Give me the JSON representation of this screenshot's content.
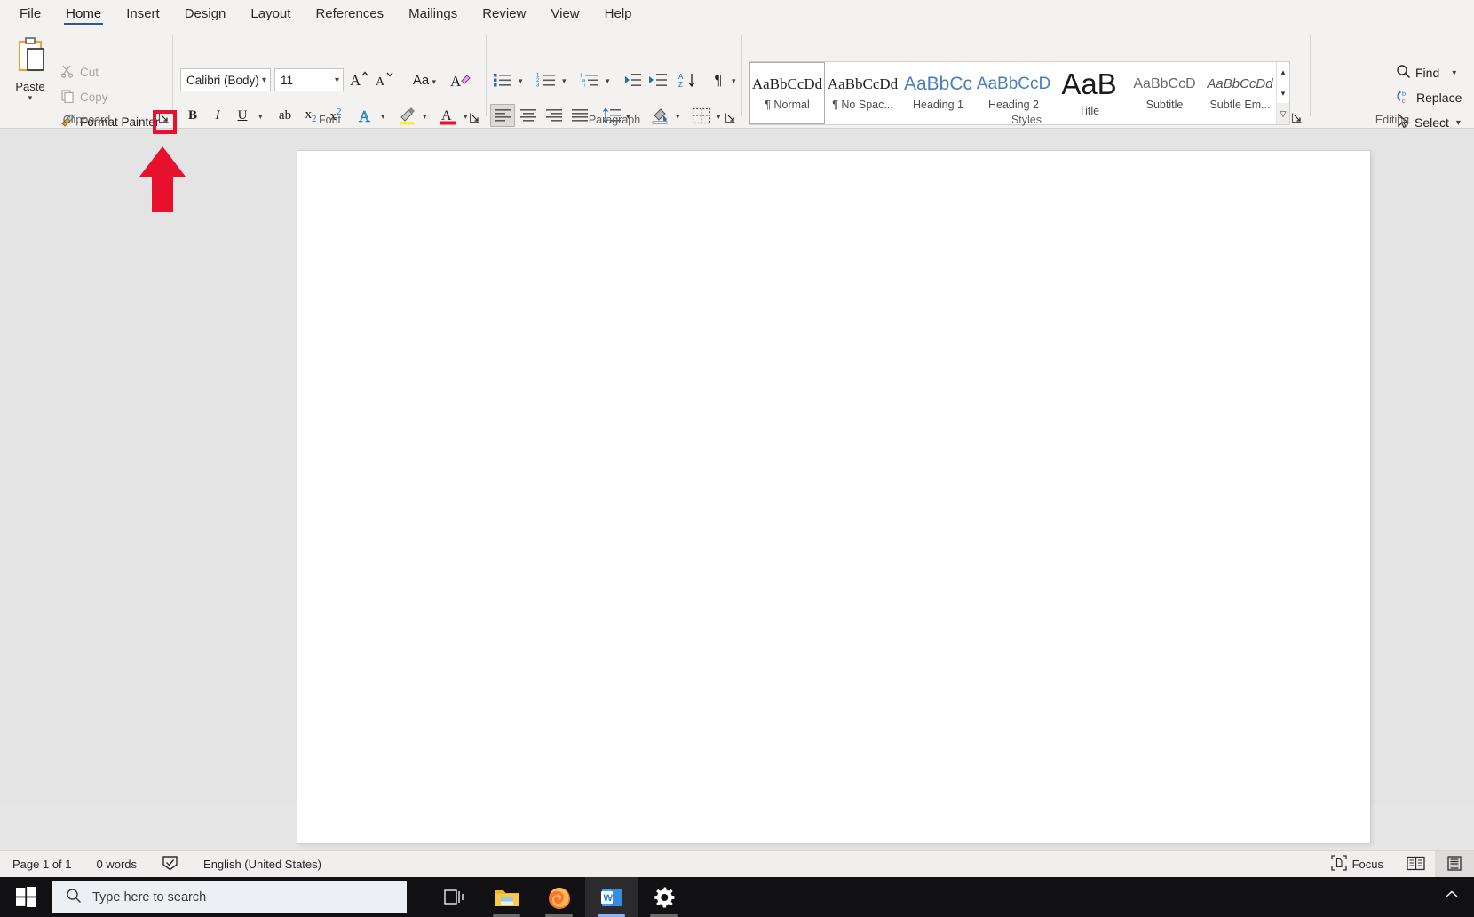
{
  "app": {
    "name": "Microsoft Word"
  },
  "ribbon": {
    "tabs": [
      {
        "label": "File",
        "active": false
      },
      {
        "label": "Home",
        "active": true
      },
      {
        "label": "Insert",
        "active": false
      },
      {
        "label": "Design",
        "active": false
      },
      {
        "label": "Layout",
        "active": false
      },
      {
        "label": "References",
        "active": false
      },
      {
        "label": "Mailings",
        "active": false
      },
      {
        "label": "Review",
        "active": false
      },
      {
        "label": "View",
        "active": false
      },
      {
        "label": "Help",
        "active": false
      }
    ],
    "clipboard": {
      "group_label": "Clipboard",
      "paste_label": "Paste",
      "cut_label": "Cut",
      "copy_label": "Copy",
      "format_painter_label": "Format Painter",
      "dialog_launcher_name": "Clipboard dialog launcher"
    },
    "font": {
      "group_label": "Font",
      "font_name": "Calibri (Body)",
      "font_size": "11",
      "grow_font": "Grow Font",
      "shrink_font": "Shrink Font",
      "change_case": "Change Case",
      "clear_formatting": "Clear All Formatting",
      "bold": "B",
      "italic": "I",
      "underline": "U",
      "strikethrough": "Strikethrough",
      "subscript": "Subscript",
      "superscript": "Superscript",
      "text_effects": "Text Effects and Typography",
      "highlight": "Text Highlight Color",
      "font_color": "Font Color"
    },
    "paragraph": {
      "group_label": "Paragraph",
      "bullets": "Bullets",
      "numbering": "Numbering",
      "multilevel": "Multilevel List",
      "decrease_indent": "Decrease Indent",
      "increase_indent": "Increase Indent",
      "sort": "Sort",
      "show_marks": "Show/Hide Paragraph Marks",
      "align_left": "Align Left",
      "align_center": "Center",
      "align_right": "Align Right",
      "justify": "Justify",
      "line_spacing": "Line and Paragraph Spacing",
      "shading": "Shading",
      "borders": "Borders"
    },
    "styles": {
      "group_label": "Styles",
      "items": [
        {
          "preview": "AaBbCcDd",
          "name": "¶ Normal",
          "selected": true,
          "style": "normal"
        },
        {
          "preview": "AaBbCcDd",
          "name": "¶ No Spac...",
          "selected": false,
          "style": "nospacing"
        },
        {
          "preview": "AaBbCc",
          "name": "Heading 1",
          "selected": false,
          "style": "heading1"
        },
        {
          "preview": "AaBbCcD",
          "name": "Heading 2",
          "selected": false,
          "style": "heading2"
        },
        {
          "preview": "AaB",
          "name": "Title",
          "selected": false,
          "style": "title"
        },
        {
          "preview": "AaBbCcD",
          "name": "Subtitle",
          "selected": false,
          "style": "subtitle"
        },
        {
          "preview": "AaBbCcDd",
          "name": "Subtle Em...",
          "selected": false,
          "style": "subtleem"
        }
      ],
      "scroll_up": "Scroll styles up",
      "scroll_down": "Scroll styles down",
      "more": "More styles"
    },
    "editing": {
      "group_label": "Editing",
      "find_label": "Find",
      "replace_label": "Replace",
      "select_label": "Select"
    }
  },
  "status": {
    "page": "Page 1 of 1",
    "words": "0 words",
    "proofing_name": "proofing-errors-icon",
    "language": "English (United States)",
    "focus_label": "Focus",
    "read_mode_name": "read-mode-icon",
    "print_layout_name": "print-layout-icon"
  },
  "taskbar": {
    "start_name": "windows-start-icon",
    "search_placeholder": "Type here to search",
    "items": [
      {
        "name": "task-view-icon",
        "active": false
      },
      {
        "name": "file-explorer-icon",
        "active": false
      },
      {
        "name": "firefox-icon",
        "active": false
      },
      {
        "name": "word-icon",
        "active": true
      },
      {
        "name": "settings-gear-icon",
        "active": false
      }
    ],
    "tray_chevron_name": "show-hidden-icons-chevron"
  },
  "annotations": {
    "highlight_name": "clipboard-launcher-highlight",
    "arrow_name": "red-up-arrow-annotation",
    "color": "#e8112d"
  }
}
